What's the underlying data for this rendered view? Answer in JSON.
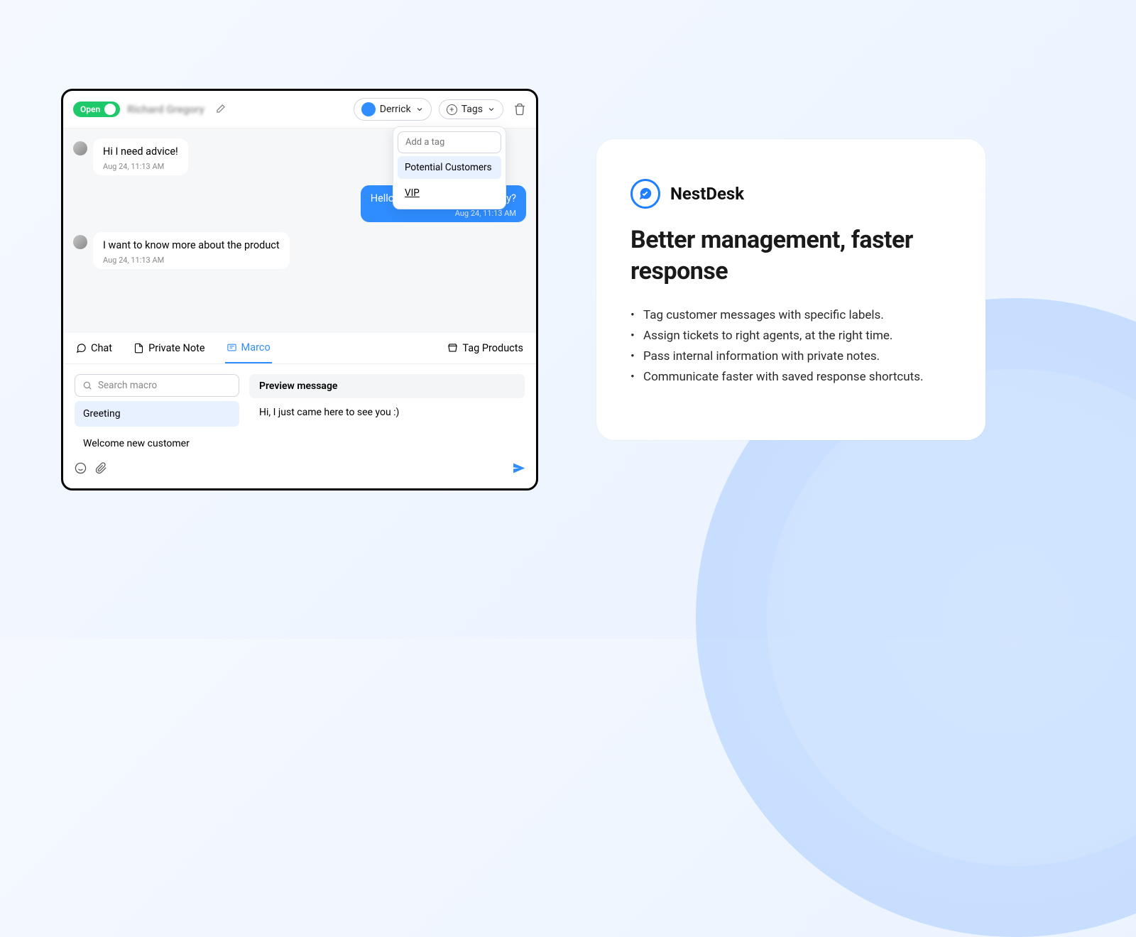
{
  "header": {
    "status": "Open",
    "customer_name": "Richard Gregory",
    "assignee": "Derrick",
    "tags_label": "Tags"
  },
  "tag_dropdown": {
    "placeholder": "Add a tag",
    "options": [
      "Potential Customers",
      "VIP"
    ]
  },
  "messages": [
    {
      "from": "them",
      "text": "Hi I need advice!",
      "time": "Aug 24, 11:13 AM"
    },
    {
      "from": "me",
      "text": "Hello, how can I help you today?",
      "time": "Aug 24, 11:13 AM"
    },
    {
      "from": "them",
      "text": "I want to know more about the product",
      "time": "Aug 24, 11:13 AM"
    }
  ],
  "compose_tabs": {
    "chat": "Chat",
    "private_note": "Private Note",
    "macro": "Marco",
    "tag_products": "Tag Products"
  },
  "macro": {
    "search_placeholder": "Search macro",
    "items": [
      "Greeting",
      "Welcome new customer"
    ],
    "preview_header": "Preview message",
    "preview_body": "Hi, I just came here to see you :)"
  },
  "card": {
    "brand": "NestDesk",
    "headline": "Better management, faster response",
    "bullets": [
      "Tag customer messages with specific labels.",
      "Assign tickets to right agents, at the right time.",
      "Pass internal information with private notes.",
      "Communicate faster with saved response shortcuts."
    ]
  }
}
